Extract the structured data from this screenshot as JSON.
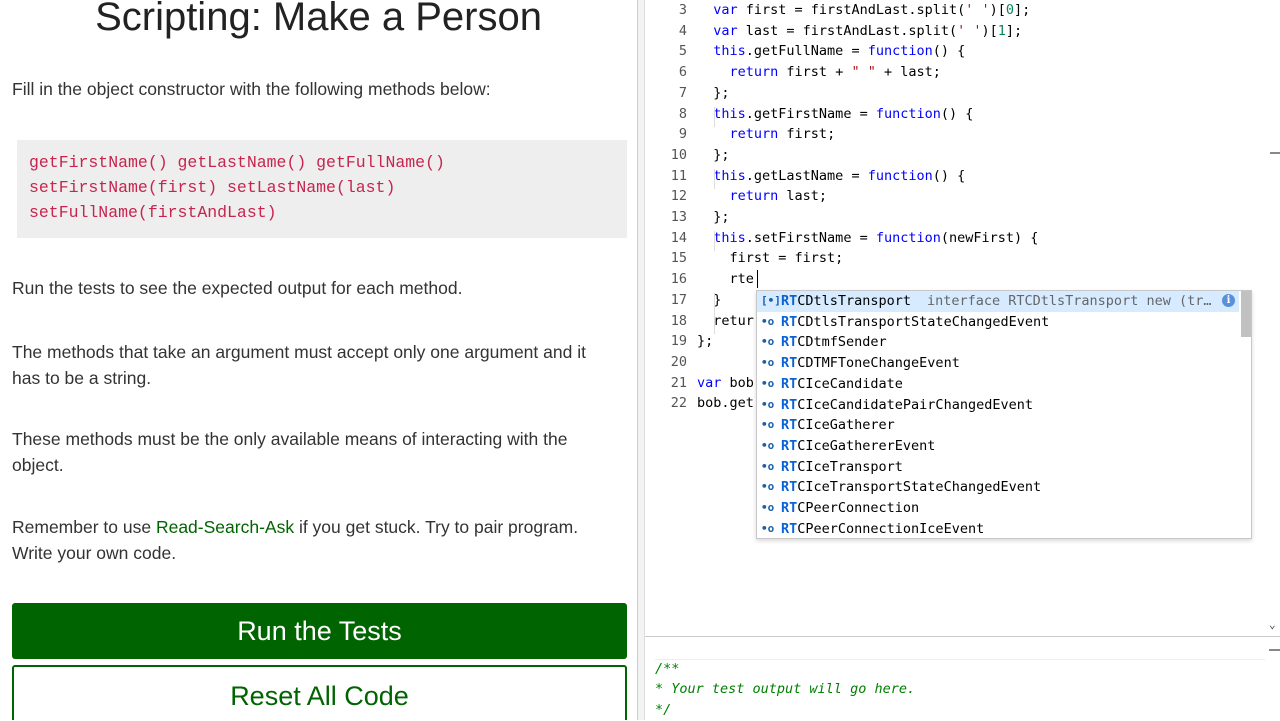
{
  "instructions": {
    "title": "Scripting: Make a Person",
    "intro": "Fill in the object constructor with the following methods below:",
    "methods_code": [
      "getFirstName() getLastName() getFullName()",
      "setFirstName(first) setLastName(last)",
      "setFullName(firstAndLast)"
    ],
    "run_tests_note": "Run the tests to see the expected output for each method.",
    "argument_note": "The methods that take an argument must accept only one argument and it has to be a string.",
    "means_note": "These methods must be the only available means of interacting with the object.",
    "remember_prefix": "Remember to use ",
    "rsa_link": "Read-Search-Ask",
    "remember_suffix": " if you get stuck. Try to pair program. Write your own code."
  },
  "buttons": {
    "run": "Run the Tests",
    "reset": "Reset All Code"
  },
  "editor": {
    "lines": [
      {
        "n": "3",
        "code": "  var first = firstAndLast.split(' ')[0];"
      },
      {
        "n": "4",
        "code": "  var last = firstAndLast.split(' ')[1];"
      },
      {
        "n": "5",
        "code": "  this.getFullName = function() {"
      },
      {
        "n": "6",
        "code": "    return first + \" \" + last;"
      },
      {
        "n": "7",
        "code": "  };"
      },
      {
        "n": "8",
        "code": "  this.getFirstName = function() {"
      },
      {
        "n": "9",
        "code": "    return first;"
      },
      {
        "n": "10",
        "code": "  };"
      },
      {
        "n": "11",
        "code": "  this.getLastName = function() {"
      },
      {
        "n": "12",
        "code": "    return last;"
      },
      {
        "n": "13",
        "code": "  };"
      },
      {
        "n": "14",
        "code": "  this.setFirstName = function(newFirst) {"
      },
      {
        "n": "15",
        "code": "    first = first;"
      },
      {
        "n": "16",
        "code": "    rte"
      },
      {
        "n": "17",
        "code": "  }"
      },
      {
        "n": "18",
        "code": "  retur"
      },
      {
        "n": "19",
        "code": "};"
      },
      {
        "n": "20",
        "code": ""
      },
      {
        "n": "21",
        "code": "var bob"
      },
      {
        "n": "22",
        "code": "bob.get"
      }
    ]
  },
  "autocomplete": {
    "match": "RT",
    "items": [
      {
        "rest": "CDtlsTransport",
        "detail": "interface RTCDtlsTransport new (tr…",
        "icon": "interface-icon"
      },
      {
        "rest": "CDtlsTransportStateChangedEvent",
        "icon": "variable-icon"
      },
      {
        "rest": "CDtmfSender",
        "icon": "variable-icon"
      },
      {
        "rest": "CDTMFToneChangeEvent",
        "icon": "variable-icon"
      },
      {
        "rest": "CIceCandidate",
        "icon": "variable-icon"
      },
      {
        "rest": "CIceCandidatePairChangedEvent",
        "icon": "variable-icon"
      },
      {
        "rest": "CIceGatherer",
        "icon": "variable-icon"
      },
      {
        "rest": "CIceGathererEvent",
        "icon": "variable-icon"
      },
      {
        "rest": "CIceTransport",
        "icon": "variable-icon"
      },
      {
        "rest": "CIceTransportStateChangedEvent",
        "icon": "variable-icon"
      },
      {
        "rest": "CPeerConnection",
        "icon": "variable-icon"
      },
      {
        "rest": "CPeerConnectionIceEvent",
        "icon": "variable-icon"
      }
    ]
  },
  "output": {
    "lines": [
      "/**",
      "* Your test output will go here.",
      "*/"
    ]
  },
  "colors": {
    "brand_green": "#006400",
    "code_pink": "#c7254e",
    "keyword_blue": "#0000ff",
    "string_red": "#a31515",
    "number_green": "#098658",
    "comment_green": "#008000",
    "suggest_selected": "#d6ebff"
  }
}
